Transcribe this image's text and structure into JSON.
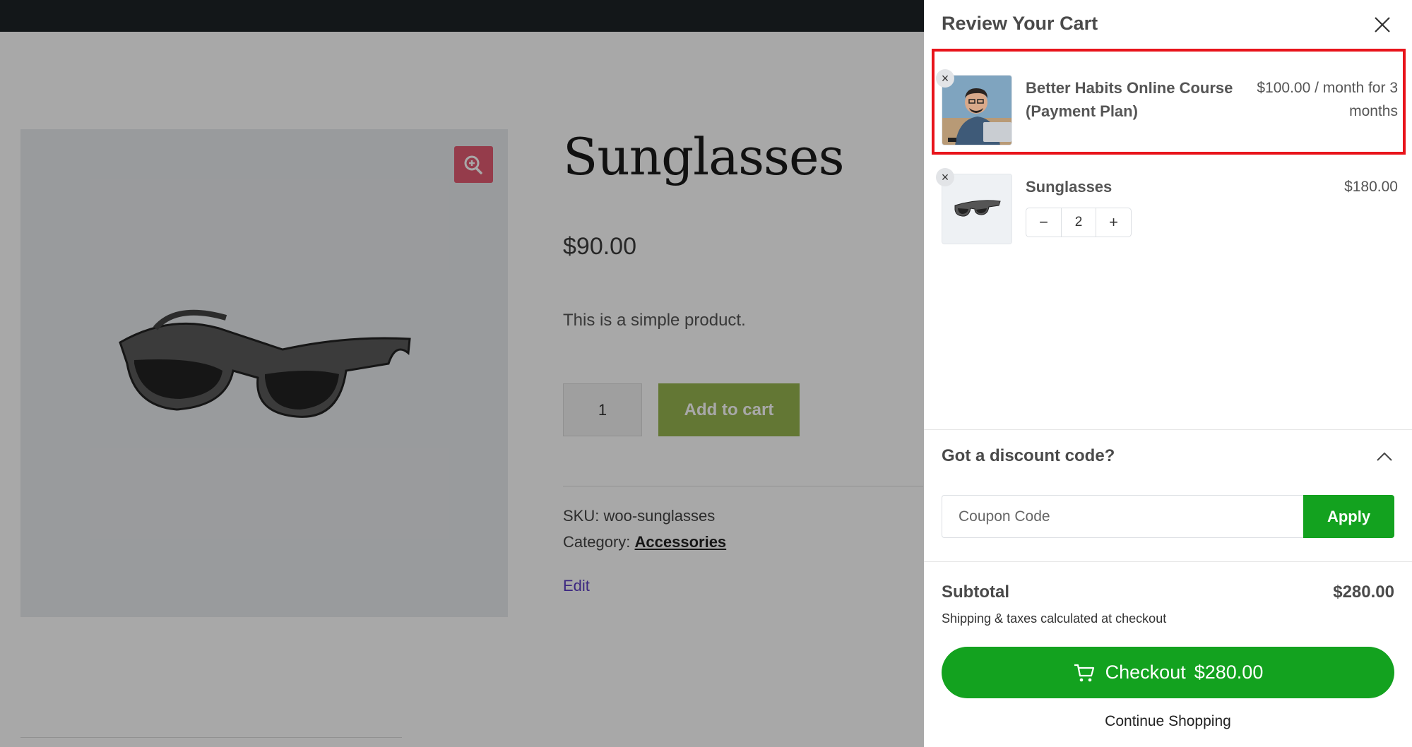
{
  "background_page": {
    "product": {
      "title": "Sunglasses",
      "price": "$90.00",
      "description": "This is a simple product.",
      "quantity": "1",
      "add_to_cart_label": "Add to cart",
      "sku_text": "SKU: woo-sunglasses",
      "category_prefix": "Category:",
      "category_link": "Accessories",
      "edit_label": "Edit"
    },
    "zoom_icon": "magnifier-plus-icon",
    "accent_colors": {
      "zoom": "#e35b72",
      "add_to_cart": "#96b54f"
    }
  },
  "cart": {
    "title": "Review Your Cart",
    "close_icon": "close-icon",
    "items": [
      {
        "name": "Better Habits Online Course (Payment Plan)",
        "price": "$100.00 / month for 3 months",
        "thumbnail": "person-with-laptop-image",
        "highlighted": true
      },
      {
        "name": "Sunglasses",
        "price": "$180.00",
        "quantity": "2",
        "thumbnail": "sunglasses-image",
        "minus_label": "−",
        "plus_label": "+"
      }
    ],
    "remove_label": "×",
    "discount": {
      "title": "Got a discount code?",
      "placeholder": "Coupon Code",
      "apply_label": "Apply"
    },
    "subtotal_label": "Subtotal",
    "subtotal_value": "$280.00",
    "shipping_note": "Shipping & taxes calculated at checkout",
    "checkout_label": "Checkout",
    "checkout_amount": "$280.00",
    "continue_label": "Continue Shopping",
    "colors": {
      "primary": "#13a21f",
      "highlight_border": "#e8141b"
    }
  }
}
